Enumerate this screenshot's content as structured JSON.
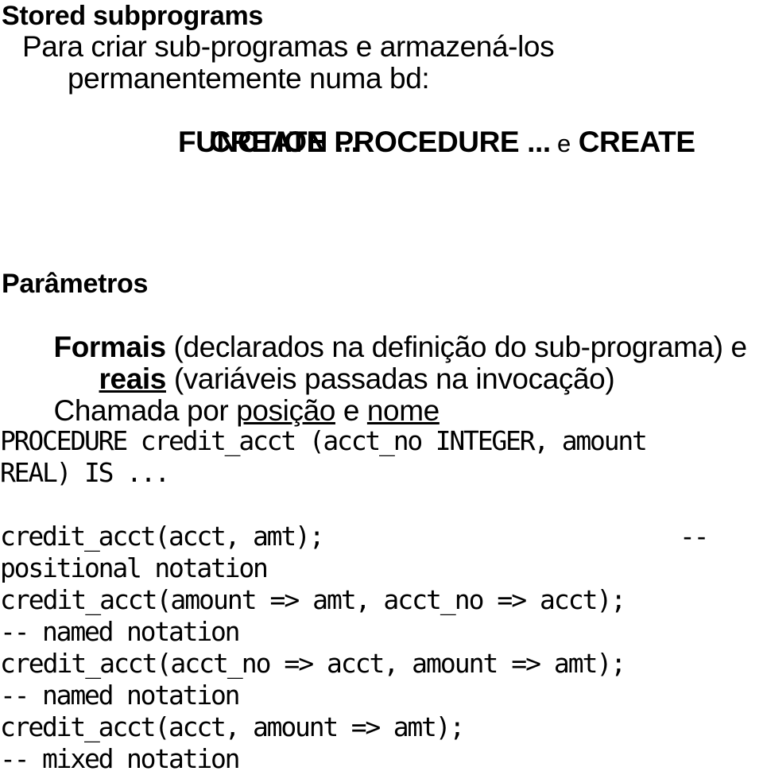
{
  "document": {
    "type": "lecture-slide",
    "language": "pt-BR",
    "background_color": "#ffffff",
    "text_color": "#000000"
  },
  "heading": {
    "title": "Stored subprograms",
    "lines": [
      {
        "id": "l1",
        "text": "Para criar sub-programas e armazená-los"
      },
      {
        "id": "l2",
        "text": "permanentemente numa bd:"
      }
    ],
    "statement": {
      "part_a": "CREATE PROCEDURE ...",
      "conjunction": "e",
      "part_b": "CREATE",
      "part_b_cont": "FUNCTION ..."
    }
  },
  "parameters": {
    "title": "Parâmetros",
    "formais_label": "Formais",
    "formais_rest": " (declarados na definição do sub-programa) e",
    "reais_label": "reais",
    "reais_rest": " (variáveis passadas na invocação)",
    "chamada_prefix": "Chamada por ",
    "chamada_term1": "posição",
    "chamada_mid": " e ",
    "chamada_term2": "nome"
  },
  "code_declaration": {
    "lines": [
      "PROCEDURE credit_acct (acct_no INTEGER, amount",
      "REAL) IS ..."
    ]
  },
  "code_invocations": {
    "lines": [
      {
        "text": "credit_acct(acct, amt);",
        "comment_inline": "--"
      },
      {
        "text": "positional notation"
      },
      {
        "text": "credit_acct(amount => amt, acct_no => acct);"
      },
      {
        "text": "-- named notation"
      },
      {
        "text": "credit_acct(acct_no => acct, amount => amt);"
      },
      {
        "text": "-- named notation"
      },
      {
        "text": "credit_acct(acct, amount => amt);"
      },
      {
        "text": "-- mixed notation"
      }
    ]
  }
}
